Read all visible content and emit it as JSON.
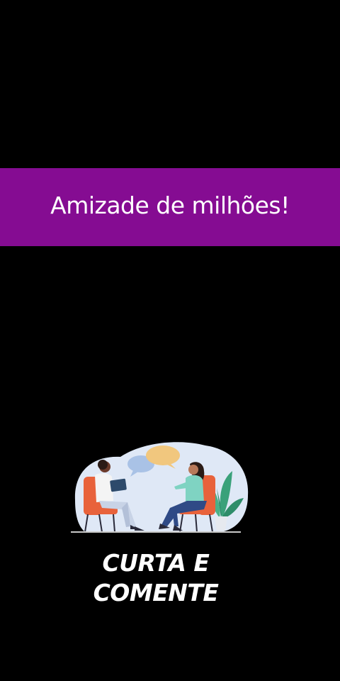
{
  "banner": {
    "text": "Amizade de milhões!",
    "background_color": "#850c92"
  },
  "illustration": {
    "icon": "two-people-conversation-illustration"
  },
  "call_to_action": {
    "line1": "CURTA E",
    "line2": "COMENTE"
  }
}
